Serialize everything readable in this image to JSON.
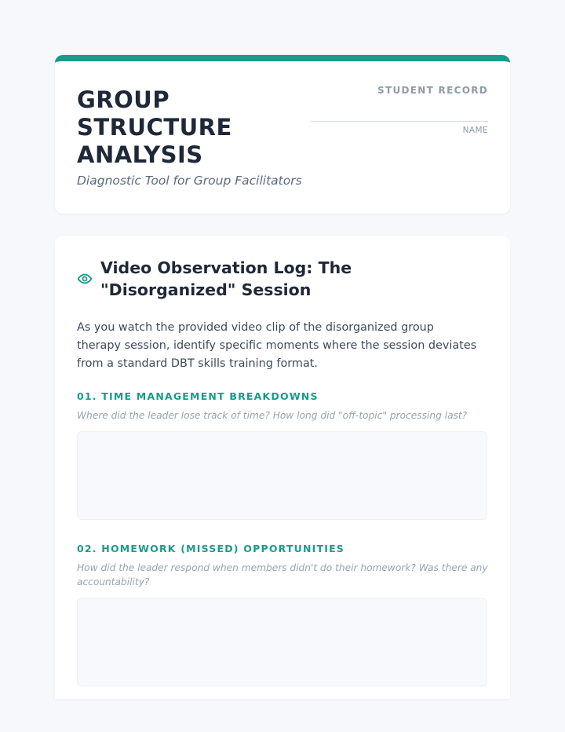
{
  "header": {
    "title": "GROUP STRUCTURE ANALYSIS",
    "subtitle": "Diagnostic Tool for Group Facilitators",
    "record_label": "STUDENT RECORD",
    "name_label": "NAME"
  },
  "section": {
    "icon": "eye-icon",
    "title": "Video Observation Log: The \"Disorganized\" Session",
    "intro": "As you watch the provided video clip of the disorganized group therapy session, identify specific moments where the session deviates from a standard DBT skills training format.",
    "questions": [
      {
        "label": "01. TIME MANAGEMENT BREAKDOWNS",
        "prompt": "Where did the leader lose track of time? How long did \"off-topic\" processing last?",
        "answer": ""
      },
      {
        "label": "02. HOMEWORK (MISSED) OPPORTUNITIES",
        "prompt": "How did the leader respond when members didn't do their homework? Was there any accountability?",
        "answer": ""
      }
    ]
  },
  "colors": {
    "accent": "#1a9a8a",
    "title_text": "#1e2838",
    "muted_text": "#98a3b3",
    "page_background": "#f6f8fb"
  }
}
